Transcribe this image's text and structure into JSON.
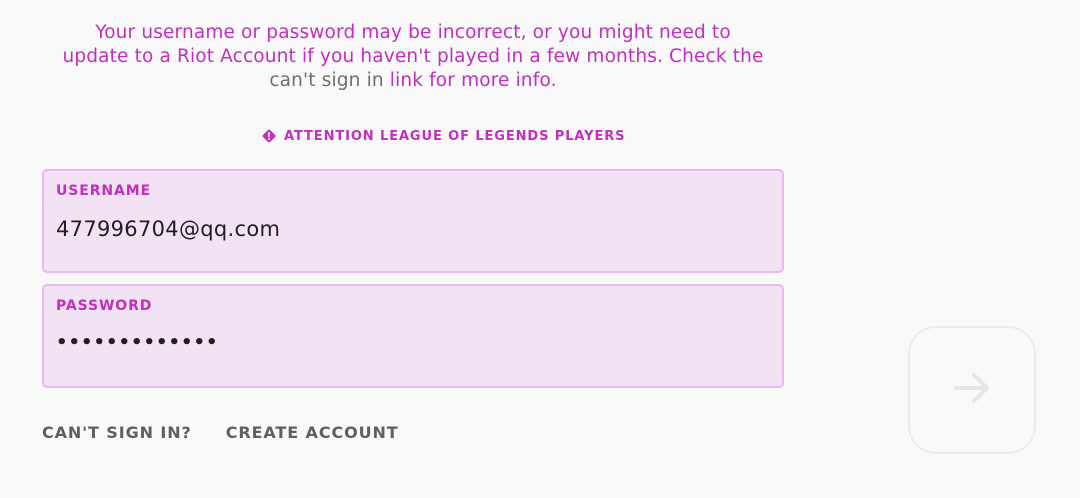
{
  "error": {
    "line1": "Your username or password may be incorrect, or you might need to",
    "line2": "update to a Riot Account if you haven't played in a few months. Check the",
    "line3_gray": "can't sign in",
    "line3_rest": " link for more info."
  },
  "attention": {
    "label": "ATTENTION LEAGUE OF LEGENDS PLAYERS",
    "icon": "warning-diamond-icon"
  },
  "username": {
    "label": "USERNAME",
    "value": "477996704@qq.com"
  },
  "password": {
    "label": "PASSWORD",
    "value": "•••••••••••••"
  },
  "links": {
    "cant_sign_in": "CAN'T SIGN IN?",
    "create_account": "CREATE ACCOUNT"
  },
  "submit": {
    "icon": "arrow-right-icon"
  },
  "colors": {
    "accent": "#c02fc0",
    "field_bg": "#f3e2f4",
    "field_border": "#e7b9ec",
    "text_gray": "#5f5f5f"
  }
}
